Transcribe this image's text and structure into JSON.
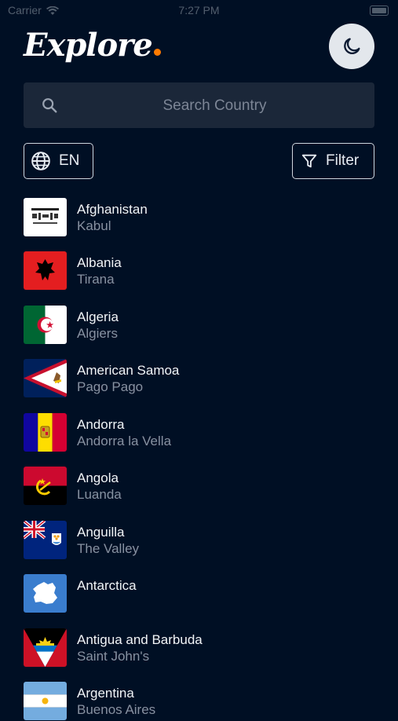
{
  "status_bar": {
    "carrier": "Carrier",
    "time": "7:27 PM"
  },
  "header": {
    "logo": "Explore",
    "theme_icon": "moon-icon"
  },
  "search": {
    "placeholder": "Search Country",
    "icon": "search-icon"
  },
  "language_button": {
    "label": "EN",
    "icon": "globe-icon"
  },
  "filter_button": {
    "label": "Filter",
    "icon": "filter-icon"
  },
  "countries": [
    {
      "name": "Afghanistan",
      "capital": "Kabul",
      "flag": "afghanistan-flag"
    },
    {
      "name": "Albania",
      "capital": "Tirana",
      "flag": "albania-flag"
    },
    {
      "name": "Algeria",
      "capital": "Algiers",
      "flag": "algeria-flag"
    },
    {
      "name": "American Samoa",
      "capital": "Pago Pago",
      "flag": "american-samoa-flag"
    },
    {
      "name": "Andorra",
      "capital": "Andorra la Vella",
      "flag": "andorra-flag"
    },
    {
      "name": "Angola",
      "capital": "Luanda",
      "flag": "angola-flag"
    },
    {
      "name": "Anguilla",
      "capital": "The Valley",
      "flag": "anguilla-flag"
    },
    {
      "name": "Antarctica",
      "capital": "",
      "flag": "antarctica-flag"
    },
    {
      "name": "Antigua and Barbuda",
      "capital": "Saint John's",
      "flag": "antigua-and-barbuda-flag"
    },
    {
      "name": "Argentina",
      "capital": "Buenos Aires",
      "flag": "argentina-flag"
    }
  ],
  "colors": {
    "background": "#000f24",
    "accent": "#ff7a00",
    "search_bg": "#1b2739"
  }
}
